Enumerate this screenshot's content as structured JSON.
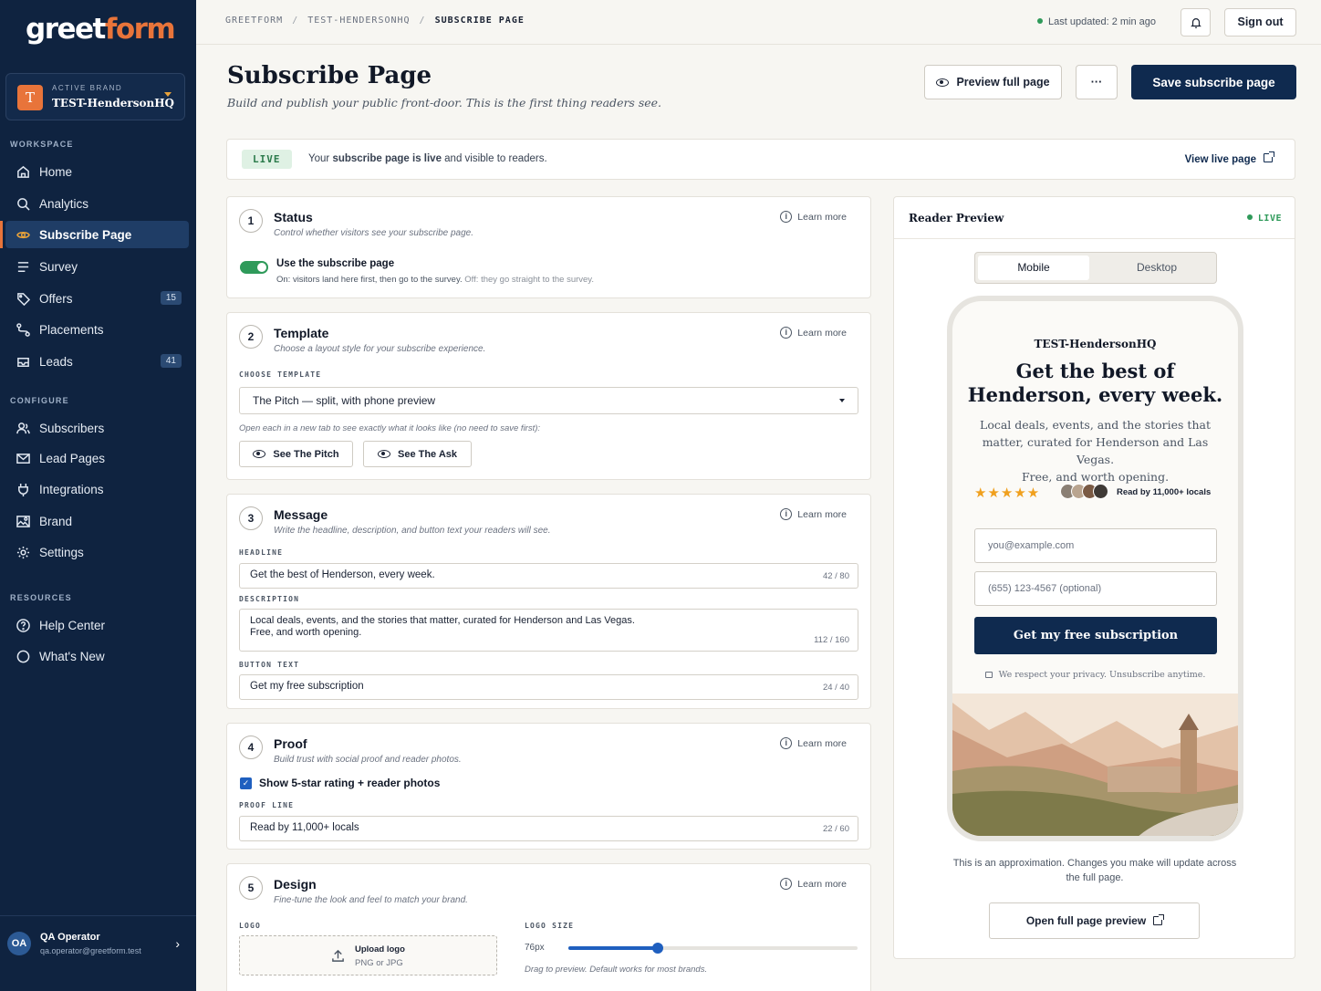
{
  "sidebar": {
    "logo_main": "greet",
    "logo_accent": "form",
    "brand_label": "ACTIVE BRAND",
    "brand_badge": "T",
    "brand_name": "TEST-HendersonHQ",
    "sections": {
      "workspace": "WORKSPACE",
      "configure": "CONFIGURE",
      "resources": "RESOURCES"
    },
    "workspace_items": [
      {
        "label": "Home",
        "icon": "home-icon"
      },
      {
        "label": "Analytics",
        "icon": "search-icon"
      },
      {
        "label": "Subscribe Page",
        "icon": "eye-icon",
        "active": true
      },
      {
        "label": "Survey",
        "icon": "list-icon"
      },
      {
        "label": "Offers",
        "icon": "tag-icon",
        "count": "15"
      },
      {
        "label": "Placements",
        "icon": "route-icon"
      },
      {
        "label": "Leads",
        "icon": "inbox-icon",
        "count": "41"
      }
    ],
    "configure_items": [
      {
        "label": "Subscribers",
        "icon": "users-icon"
      },
      {
        "label": "Lead Pages",
        "icon": "mail-icon"
      },
      {
        "label": "Integrations",
        "icon": "plug-icon"
      },
      {
        "label": "Brand",
        "icon": "image-icon"
      },
      {
        "label": "Settings",
        "icon": "gear-icon"
      }
    ],
    "resource_items": [
      {
        "label": "Help Center",
        "icon": "help-icon"
      },
      {
        "label": "What's New",
        "icon": "circle-icon"
      }
    ],
    "user": {
      "initials": "OA",
      "name": "QA Operator",
      "email": "qa.operator@greetform.test"
    }
  },
  "topbar": {
    "breadcrumb": [
      "GREETFORM",
      "TEST-HENDERSONHQ",
      "SUBSCRIBE PAGE"
    ],
    "updated": "Last updated: 2 min ago",
    "sign_out": "Sign out"
  },
  "header": {
    "title": "Subscribe Page",
    "subtitle": "Build and publish your public front-door. This is the first thing readers see.",
    "preview_btn": "Preview full page",
    "more_btn": "···",
    "save_btn": "Save subscribe page"
  },
  "banner": {
    "pill": "LIVE",
    "text_pre": "Your ",
    "text_bold": "subscribe page is live",
    "text_post": " and visible to readers.",
    "link": "View live page"
  },
  "learn_more": "Learn more",
  "status": {
    "num": "1",
    "title": "Status",
    "desc": "Control whether visitors see your subscribe page.",
    "toggle_label": "Use the subscribe page",
    "toggle_on": true,
    "help_on": "On: visitors land here first, then go to the survey.",
    "help_off": "Off: they go straight to the survey."
  },
  "template": {
    "num": "2",
    "title": "Template",
    "desc": "Choose a layout style for your subscribe experience.",
    "label": "CHOOSE TEMPLATE",
    "selected": "The Pitch — split, with phone preview",
    "hint": "Open each in a new tab to see exactly what it looks like (no need to save first):",
    "see_pitch": "See The Pitch",
    "see_ask": "See The Ask"
  },
  "message": {
    "num": "3",
    "title": "Message",
    "desc": "Write the headline, description, and button text your readers will see.",
    "headline_label": "HEADLINE",
    "headline": "Get the best of Henderson, every week.",
    "headline_count": "42 / 80",
    "description_label": "DESCRIPTION",
    "description_line1": "Local deals, events, and the stories that matter, curated for Henderson and Las Vegas.",
    "description_line2": "Free, and worth opening.",
    "description_count": "112 / 160",
    "button_label": "BUTTON TEXT",
    "button": "Get my free subscription",
    "button_count": "24 / 40"
  },
  "proof": {
    "num": "4",
    "title": "Proof",
    "desc": "Build trust with social proof and reader photos.",
    "checkbox": "Show 5-star rating + reader photos",
    "checked": true,
    "line_label": "PROOF LINE",
    "line": "Read by 11,000+ locals",
    "line_count": "22 / 60"
  },
  "design": {
    "num": "5",
    "title": "Design",
    "desc": "Fine-tune the look and feel to match your brand.",
    "logo_label": "LOGO",
    "upload": "Upload logo",
    "upload_hint": "PNG or JPG",
    "size_label": "LOGO SIZE",
    "size_value": "76px",
    "size_fraction": 0.31,
    "size_hint": "Drag to preview. Default works for most brands."
  },
  "preview": {
    "title": "Reader Preview",
    "live": "LIVE",
    "tabs": [
      "Mobile",
      "Desktop"
    ],
    "brand": "TEST-HendersonHQ",
    "headline_1": "Get the best of",
    "headline_2": "Henderson, every week.",
    "desc_1": "Local deals, events, and the stories that",
    "desc_2": "matter, curated for Henderson and Las Vegas.",
    "desc_3": "Free, and worth opening.",
    "stars": "★★★★★",
    "read_by": "Read by 11,000+ locals",
    "email_placeholder": "you@example.com",
    "phone_placeholder": "(655) 123-4567 (optional)",
    "cta": "Get my free subscription",
    "privacy": "We respect your privacy. Unsubscribe anytime.",
    "note": "This is an approximation. Changes you make will update across the full page.",
    "open_btn": "Open full page preview"
  },
  "colors": {
    "navy": "#0f2340",
    "accent": "#e8743a",
    "live_green": "#2f9a5a",
    "primary": "#0f2a4f"
  }
}
